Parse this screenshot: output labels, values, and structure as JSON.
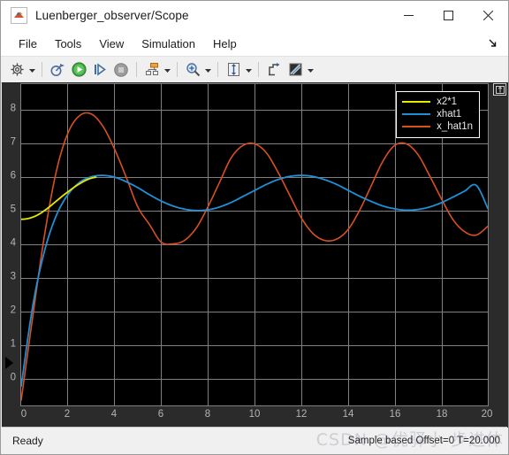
{
  "window": {
    "title": "Luenberger_observer/Scope",
    "app_icon": "matlab-membrane-icon",
    "minimize_label": "–",
    "maximize_label": "□",
    "close_label": "✕"
  },
  "menubar": {
    "items": [
      {
        "label": "File",
        "name": "menu-file"
      },
      {
        "label": "Tools",
        "name": "menu-tools"
      },
      {
        "label": "View",
        "name": "menu-view"
      },
      {
        "label": "Simulation",
        "name": "menu-simulation"
      },
      {
        "label": "Help",
        "name": "menu-help"
      }
    ],
    "overflow_icon": "menu-overflow-icon"
  },
  "toolbar": {
    "buttons": [
      {
        "name": "configuration-properties-button",
        "icon": "gear-icon",
        "has_dropdown": true
      },
      {
        "name": "run-back-to-start-button",
        "icon": "rewind-icon",
        "has_dropdown": false
      },
      {
        "name": "run-button",
        "icon": "play-icon",
        "has_dropdown": false
      },
      {
        "name": "step-forward-button",
        "icon": "step-forward-icon",
        "has_dropdown": false
      },
      {
        "name": "stop-button",
        "icon": "stop-icon",
        "has_dropdown": false
      },
      {
        "name": "layout-button",
        "icon": "layout-icon",
        "has_dropdown": true
      },
      {
        "name": "zoom-in-button",
        "icon": "zoom-in-icon",
        "has_dropdown": true
      },
      {
        "name": "autoscale-button",
        "icon": "autoscale-icon",
        "has_dropdown": true
      },
      {
        "name": "cursor-measurements-button",
        "icon": "cursor-measurement-icon",
        "has_dropdown": false
      },
      {
        "name": "style-button",
        "icon": "style-icon",
        "has_dropdown": true
      }
    ]
  },
  "plot": {
    "maximize_axes_icon": "maximize-axes-icon",
    "scroll_caret_icon": "scroll-caret-icon",
    "background": "#000000",
    "grid_color": "#808080",
    "legend": [
      {
        "label": "x2*1",
        "color": "#e8e800",
        "name": "legend-item-x2-1"
      },
      {
        "label": "xhat1",
        "color": "#1f8fd6",
        "name": "legend-item-xhat1"
      },
      {
        "label": "x_hat1n",
        "color": "#d9501f",
        "name": "legend-item-x-hat1n"
      }
    ]
  },
  "chart_data": {
    "type": "line",
    "title": "",
    "xlabel": "",
    "ylabel": "",
    "xlim": [
      0,
      20
    ],
    "ylim": [
      -0.55,
      8.6
    ],
    "xticks": [
      0,
      2,
      4,
      6,
      8,
      10,
      12,
      14,
      16,
      18,
      20
    ],
    "yticks": [
      0,
      1,
      2,
      3,
      4,
      5,
      6,
      7,
      8
    ],
    "grid": true,
    "legend_position": "top-right",
    "series": [
      {
        "name": "x2*1",
        "color": "#e8e800",
        "x": [
          0,
          0.2,
          0.4,
          0.6,
          0.8,
          1.0,
          1.2,
          1.4,
          1.6,
          1.8,
          2.0,
          2.2,
          2.4,
          2.6,
          2.8,
          3.0,
          3.2
        ],
        "values": [
          4.75,
          4.76,
          4.79,
          4.84,
          4.91,
          5.0,
          5.1,
          5.21,
          5.32,
          5.43,
          5.53,
          5.63,
          5.72,
          5.8,
          5.87,
          5.92,
          5.95
        ]
      },
      {
        "name": "xhat1",
        "color": "#1f8fd6",
        "x": [
          0,
          0.5,
          1.0,
          1.5,
          2.0,
          2.5,
          3.0,
          3.5,
          4.0,
          4.5,
          5.0,
          5.5,
          6.0,
          6.5,
          7.0,
          7.5,
          8.0,
          8.5,
          9.0,
          9.5,
          10.0,
          10.5,
          11.0,
          11.5,
          12.0,
          12.5,
          13.0,
          13.5,
          14.0,
          14.5,
          15.0,
          15.5,
          16.0,
          16.5,
          17.0,
          17.5,
          18.0,
          18.5,
          19.0,
          19.5,
          20.0
        ],
        "values": [
          0.0,
          2.3,
          3.85,
          4.85,
          5.45,
          5.8,
          5.96,
          6.0,
          5.95,
          5.82,
          5.65,
          5.45,
          5.27,
          5.13,
          5.04,
          5.0,
          5.02,
          5.1,
          5.23,
          5.4,
          5.57,
          5.74,
          5.88,
          5.97,
          6.0,
          5.97,
          5.88,
          5.75,
          5.58,
          5.41,
          5.26,
          5.13,
          5.05,
          5.01,
          5.03,
          5.1,
          5.22,
          5.38,
          5.55,
          5.72,
          5.06
        ]
      },
      {
        "name": "x_hat1n",
        "color": "#d9501f",
        "x": [
          0,
          0.5,
          1.0,
          1.5,
          2.0,
          2.5,
          3.0,
          3.5,
          4.0,
          4.5,
          5.0,
          5.5,
          6.0,
          6.5,
          7.0,
          7.5,
          8.0,
          8.5,
          9.0,
          9.5,
          10.0,
          10.5,
          11.0,
          11.5,
          12.0,
          12.5,
          13.0,
          13.5,
          14.0,
          14.5,
          15.0,
          15.5,
          16.0,
          16.5,
          17.0,
          17.5,
          18.0,
          18.5,
          19.0,
          19.5,
          20.0
        ],
        "values": [
          -0.4,
          2.0,
          4.3,
          6.1,
          7.2,
          7.7,
          7.75,
          7.4,
          6.75,
          5.95,
          5.1,
          4.6,
          4.1,
          4.05,
          4.15,
          4.5,
          5.1,
          5.8,
          6.5,
          6.85,
          6.9,
          6.65,
          6.1,
          5.45,
          4.8,
          4.35,
          4.15,
          4.18,
          4.45,
          5.0,
          5.7,
          6.4,
          6.85,
          6.9,
          6.6,
          6.0,
          5.35,
          4.75,
          4.4,
          4.3,
          4.55
        ]
      }
    ]
  },
  "statusbar": {
    "left_text": "Ready",
    "right_text": "Sample based    Offset=0    T=20.000",
    "watermark": "CSDN @优驿小 步进体"
  }
}
